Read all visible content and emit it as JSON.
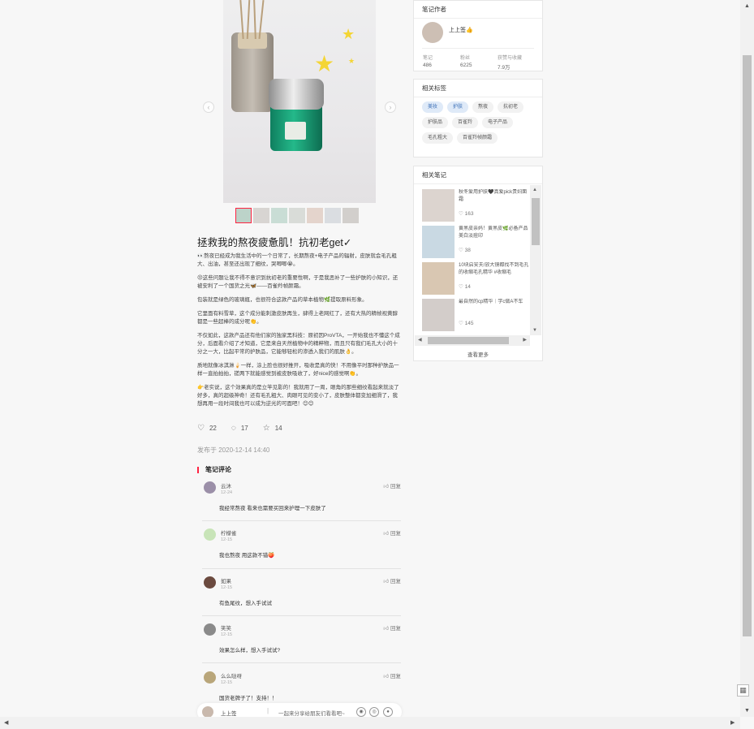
{
  "note": {
    "title": "拯救我的熬夜疲惫肌！抗初老get✓",
    "paragraphs": [
      "👀熬夜已经成为我生活中的一个日常了，长期熬夜+电子产品的辐射，皮肤就会毛孔粗大、出油，甚至还出现了细纹，哭唧唧😭。",
      "😣这些问题让我不得不意识到抗初老的重要性啊，于是我恶补了一些护肤的小知识，还被安利了一个国货之光🦋——百雀羚帧颜霜。",
      "包装就是绿色的玻璃瓶，也很符合这款产品的草本植物🌿提取原料形象。",
      "它里面有料雪草，这个成分能刺激皮肤再生，肆得上老网红了，还有大热的精帧视黄醇都是一些超棒的成分呢👏。",
      "不仅如此，这款产品还有他们家的独家黑科技：原初因ProVTA，一开始我也不懂这个成分，后面看介绍了才知道，它是来自天然植物中的精粹物，而且只有我们毛孔大小的十分之一大，比起平常的护肤品，它能够轻松的渗透入我们的肌肤👌。",
      "质地就像冰淇淋🍦一样，涂上脸也很好推开，吸收是真的快！不用像平时那种护肤品一样一直拍拍拍，搓两下就能感觉到被皮肤吸收了，好nice的感觉啊👏。",
      "👉老实说，这个效果真的是立竿见影的！我就用了一周，眼角的那些细纹看起来就淡了好多，真的超级神奇！还有毛孔粗大、肉眼可见的变小了，皮肤整体都变加细滑了，我想再用一段时间我也可以成为逆光的可面吧！😊😊"
    ],
    "likes": "22",
    "comments_count": "17",
    "collects": "14",
    "published": "发布于 2020-12-14 14:40"
  },
  "comments": {
    "heading": "笔记评论",
    "reply_label": "回复",
    "items": [
      {
        "name": "云沐",
        "date": "12-24",
        "text": "我经常熬夜 看来也需要买回来护理一下皮肤了"
      },
      {
        "name": "柠檬雀",
        "date": "12-15",
        "text": "我也熬夜 用这款不错🍑"
      },
      {
        "name": "如果",
        "date": "12-15",
        "text": "有鱼尾纹，想入手试试"
      },
      {
        "name": "笑笑",
        "date": "12-15",
        "text": "效果怎么样，想入手试试?"
      },
      {
        "name": "么么哒呀",
        "date": "12-15",
        "text": "国货老牌子了！支持！！"
      }
    ]
  },
  "footer": {
    "name": "上上签",
    "prompt": "一起来分享给朋友们看看吧~"
  },
  "author": {
    "heading": "笔记作者",
    "name": "上上签👍",
    "stats": [
      {
        "label": "笔记",
        "value": "486"
      },
      {
        "label": "粉丝",
        "value": "6225"
      },
      {
        "label": "获赞与收藏",
        "value": "7.9万"
      }
    ]
  },
  "tags": {
    "heading": "相关标签",
    "items": [
      {
        "label": "美妆",
        "highlight": true
      },
      {
        "label": "护肤",
        "highlight": true
      },
      {
        "label": "熬夜",
        "highlight": false
      },
      {
        "label": "抗初老",
        "highlight": false
      },
      {
        "label": "护肤品",
        "highlight": false
      },
      {
        "label": "百雀羚",
        "highlight": false
      },
      {
        "label": "电子产品",
        "highlight": false
      },
      {
        "label": "毛孔粗大",
        "highlight": false
      },
      {
        "label": "百雀羚帧颜霜",
        "highlight": false
      }
    ]
  },
  "related": {
    "heading": "相关笔记",
    "see_more": "查看更多",
    "items": [
      {
        "title": "秋冬爱用护肤🖤真爱pick贵妇面霜",
        "likes": "163"
      },
      {
        "title": "黄黑皮亲妈！黄黑皮🌿必备产品美白淡痘印",
        "likes": "38"
      },
      {
        "title": "10块启安夫/放大镜都找不到毛孔的收缩毛孔精华 #收缩毛",
        "likes": "14"
      },
      {
        "title": "最自然的cp精华｜学c做A不车",
        "likes": "145"
      }
    ]
  }
}
